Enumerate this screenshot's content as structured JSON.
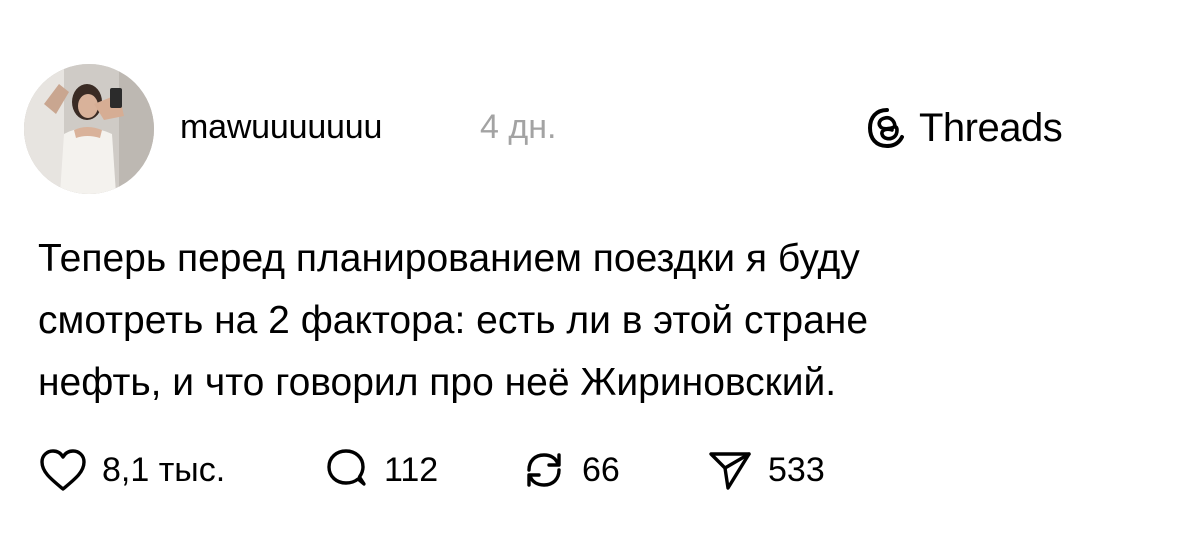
{
  "post": {
    "username": "mawuuuuuuu",
    "timestamp": "4 дн.",
    "brand_label": "Threads",
    "text_lines": [
      "Теперь перед планированием поездки я буду",
      "смотреть на 2 фактора: есть ли в этой стране",
      "нефть, и что говорил про неё Жириновский."
    ],
    "actions": {
      "likes": "8,1 тыс.",
      "replies": "112",
      "reposts": "66",
      "shares": "533"
    }
  },
  "icons": {
    "like": "heart-icon",
    "reply": "speech-bubble-icon",
    "repost": "repost-arrows-icon",
    "share": "paper-plane-icon",
    "brand": "threads-logo-icon"
  }
}
